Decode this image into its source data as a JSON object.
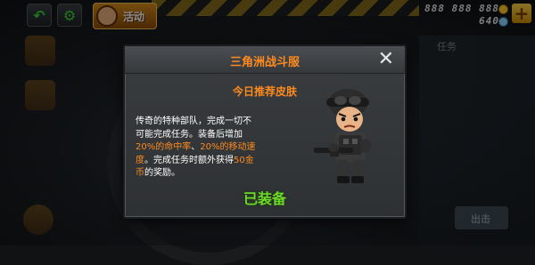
{
  "topbar": {
    "back_icon": "back-arrow-icon",
    "settings_icon": "gear-icon",
    "activity_label": "活动",
    "currency1": "888 888 888",
    "currency2": "640",
    "plus_icon": "plus-icon"
  },
  "background": {
    "right_panel_title": "任务",
    "right_panel_button": "出击"
  },
  "dialog": {
    "title": "三角洲战斗服",
    "subtitle": "今日推荐皮肤",
    "desc_1": "传奇的特种部队，完成一切不可能完成任务。装备后增加",
    "desc_hl1": "20%的命中率",
    "desc_2": "、",
    "desc_hl2": "20%的移动速度",
    "desc_3": "。完成任务时额外获得",
    "desc_hl3": "50金币",
    "desc_4": "的奖励。",
    "status": "已装备",
    "colors": {
      "accent": "#ff8a1e",
      "equipped": "#6cd82a"
    }
  }
}
